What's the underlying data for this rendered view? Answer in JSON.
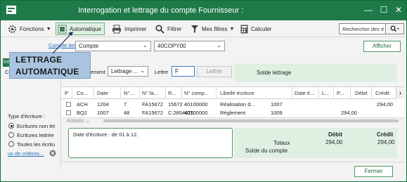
{
  "window": {
    "title": "Interrogation et lettrage du compte Fournisseur :",
    "controls": {
      "minimize": "—",
      "maximize": "☐",
      "close": "✕"
    },
    "accent_color": "#1f7a4a"
  },
  "toolbar": {
    "fonctions": "Fonctions",
    "automatique": "Automatique",
    "imprimer": "Imprimer",
    "filtrer": "Filtrer",
    "mes_filtres": "Mes filtres",
    "calculer": "Calculer",
    "search_placeholder": "Rechercher des é"
  },
  "filter": {
    "compte_tiers_label": "Compte tiers",
    "type_value": "Compte",
    "account_value": "40COPY00",
    "afficher": "Afficher"
  },
  "callout": {
    "line1": "LETTRAGE",
    "line2": "AUTOMATIQUE"
  },
  "lettrage": {
    "rapprochement_label": "ement",
    "mode_value": "Lettrage ...",
    "lettre_label": "Lettre",
    "lettre_value": "F",
    "lettrer_button": "Lettrer",
    "solde_label": "Solde lettrage"
  },
  "left": {
    "tab_label": "Int",
    "cu_label": "Cu",
    "type_ecriture_label": "Type d'écriture :",
    "options": [
      "Ecritures non let",
      "Ecritures lettrée",
      "Toutes les écritu"
    ],
    "selected_index": 0,
    "plus_criteres": "us de critères..."
  },
  "grid": {
    "headers": [
      "P",
      "Co...",
      "Date",
      "N°...",
      "N° fa...",
      "R...",
      "N° comp...",
      "Libellé écriture",
      "Date é...",
      "L...",
      "P...",
      "Débit",
      "Crédit"
    ],
    "rows": [
      [
        "",
        "ACH",
        "1204",
        "7",
        "FA15672",
        "15672",
        "40100000",
        "Réalisation d...",
        "1007",
        "",
        "",
        "",
        "294,00"
      ],
      [
        "",
        "BQ2",
        "1007",
        "48",
        "FA15672",
        "C.2854625",
        "40100000",
        "Règlement",
        "1009",
        "",
        "",
        "294,00",
        ""
      ]
    ],
    "actions_label": "Actions"
  },
  "bottom": {
    "description": "Date d'écriture : de 01 à 12.",
    "debit_header": "Débit",
    "credit_header": "Crédit",
    "totaux_label": "Totaux",
    "totaux_debit": "294,00",
    "totaux_credit": "294,00",
    "solde_label": "Solde du compte",
    "fermer": "Fermer"
  }
}
